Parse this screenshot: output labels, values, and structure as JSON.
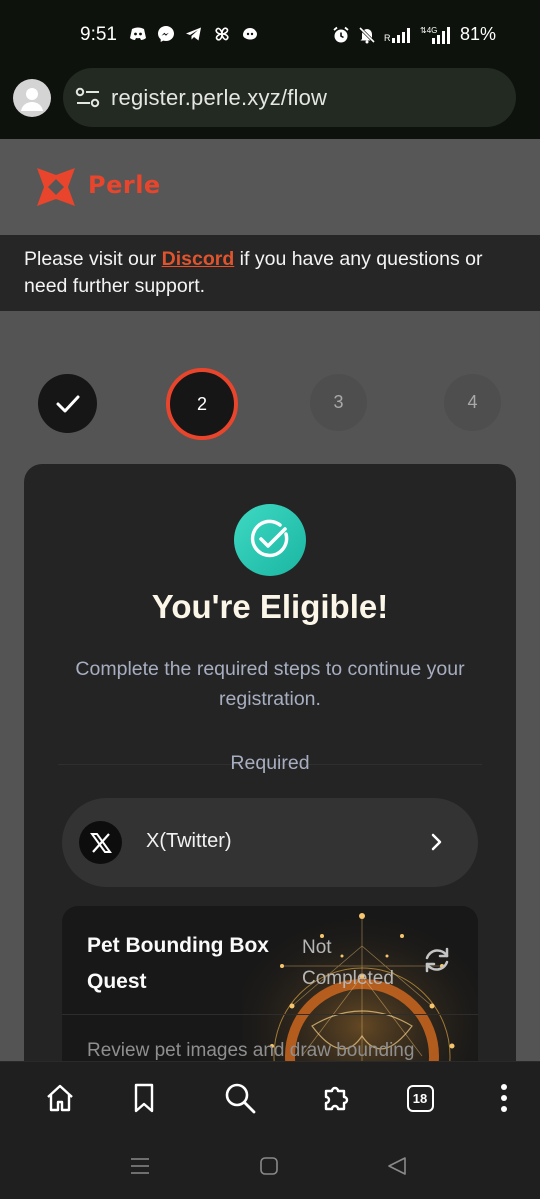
{
  "status_bar": {
    "time": "9:51",
    "battery": "81%",
    "icons_left": [
      "discord-icon",
      "messenger-icon",
      "telegram-icon",
      "pinwheel-icon",
      "chatgpt-icon"
    ],
    "icons_right": [
      "alarm-icon",
      "silent-icon",
      "signal-icon",
      "4g-signal-icon"
    ]
  },
  "browser": {
    "url": "register.perle.xyz/flow"
  },
  "site": {
    "logo_text": "Perle",
    "notice_prefix": "Please visit our ",
    "notice_link": "Discord",
    "notice_suffix": " if you have any questions or need further support."
  },
  "stepper": {
    "steps": [
      "✓",
      "2",
      "3",
      "4"
    ],
    "current": 2
  },
  "card": {
    "title": "You're Eligible!",
    "subtitle": "Complete the required steps to continue your registration.",
    "required_label": "Required",
    "task": {
      "label": "X(Twitter)"
    },
    "quest": {
      "title": "Pet Bounding Box Quest",
      "status": "Not Completed",
      "description": "Review pet images and draw bounding"
    }
  },
  "toolbar": {
    "tab_count": "18",
    "buttons": [
      "home-icon",
      "bookmark-icon",
      "search-icon",
      "extensions-icon",
      "tabs-icon",
      "more-icon"
    ]
  },
  "colors": {
    "accent": "#e8452c",
    "success": "#2cc9b4",
    "card_bg": "#242424",
    "page_bg": "#545454"
  }
}
